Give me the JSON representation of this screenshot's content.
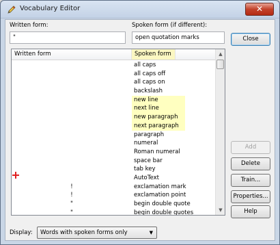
{
  "window": {
    "title": "Vocabulary Editor",
    "close_glyph": "✕"
  },
  "fields": {
    "written_label": "Written form:",
    "written_value": "\"",
    "spoken_label": "Spoken form (if different):",
    "spoken_value": "open quotation marks"
  },
  "buttons": {
    "close": "Close",
    "add": "Add",
    "delete": "Delete",
    "train": "Train...",
    "properties": "Properties...",
    "help": "Help"
  },
  "list": {
    "columns": [
      "Written form",
      "Spoken form"
    ],
    "rows": [
      {
        "written": "",
        "spoken": "all caps",
        "hl": false
      },
      {
        "written": "",
        "spoken": "all caps off",
        "hl": false
      },
      {
        "written": "",
        "spoken": "all caps on",
        "hl": false
      },
      {
        "written": "",
        "spoken": "backslash",
        "hl": false
      },
      {
        "written": "",
        "spoken": "new line",
        "hl": true
      },
      {
        "written": "",
        "spoken": "next line",
        "hl": true
      },
      {
        "written": "",
        "spoken": "new paragraph",
        "hl": true
      },
      {
        "written": "",
        "spoken": "next paragraph",
        "hl": true
      },
      {
        "written": "",
        "spoken": "paragraph",
        "hl": false
      },
      {
        "written": "",
        "spoken": "numeral",
        "hl": false
      },
      {
        "written": "",
        "spoken": "Roman numeral",
        "hl": false
      },
      {
        "written": "",
        "spoken": "space bar",
        "hl": false
      },
      {
        "written": "",
        "spoken": "tab key",
        "hl": false
      },
      {
        "written": "",
        "spoken": "AutoText",
        "hl": false
      },
      {
        "written": "!",
        "spoken": "exclamation mark",
        "hl": false
      },
      {
        "written": "!",
        "spoken": "exclamation point",
        "hl": false
      },
      {
        "written": "\"",
        "spoken": "begin double quote",
        "hl": false
      },
      {
        "written": "\"",
        "spoken": "begin double quotes",
        "hl": false
      }
    ]
  },
  "display": {
    "label": "Display:",
    "selected": "Words with spoken forms only"
  },
  "colors": {
    "highlight": "#ffffc0",
    "close_red": "#c3422b",
    "cursor_red": "#e02020"
  },
  "icons": {
    "title": "pencil-icon",
    "cursor": "plus-cursor-icon"
  }
}
